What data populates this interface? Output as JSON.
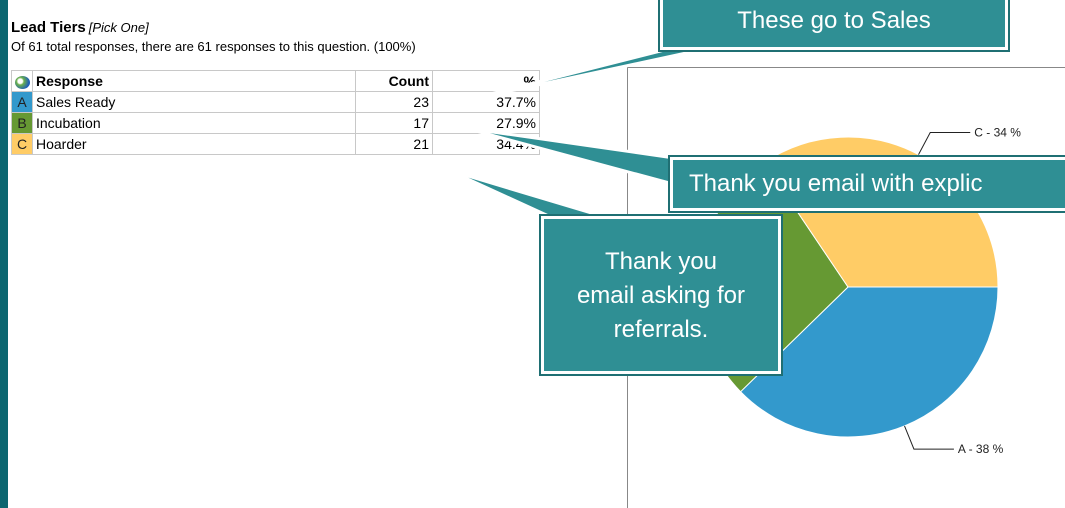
{
  "question": {
    "title": "Lead Tiers",
    "type": "[Pick One]",
    "summary": "Of 61 total responses, there are 61 responses to this question. (100%)"
  },
  "table": {
    "headers": {
      "response": "Response",
      "count": "Count",
      "percent": "%"
    },
    "rows": [
      {
        "letter": "A",
        "label": "Sales Ready",
        "count": "23",
        "percent": "37.7%",
        "color": "#3399cc"
      },
      {
        "letter": "B",
        "label": "Incubation",
        "count": "17",
        "percent": "27.9%",
        "color": "#669933"
      },
      {
        "letter": "C",
        "label": "Hoarder",
        "count": "21",
        "percent": "34.4%",
        "color": "#ffcc66"
      }
    ]
  },
  "callouts": {
    "sales": "These go to Sales",
    "thanks": "Thank you email with explic",
    "referral_line1": "Thank you",
    "referral_line2": "email asking for",
    "referral_line3": "referrals."
  },
  "chart_data": {
    "type": "pie",
    "categories": [
      "A",
      "B",
      "C"
    ],
    "values": [
      23,
      17,
      21
    ],
    "colors": [
      "#3399cc",
      "#669933",
      "#ffcc66"
    ],
    "slice_labels": [
      "A - 38 %",
      "",
      "C - 34 %"
    ]
  }
}
